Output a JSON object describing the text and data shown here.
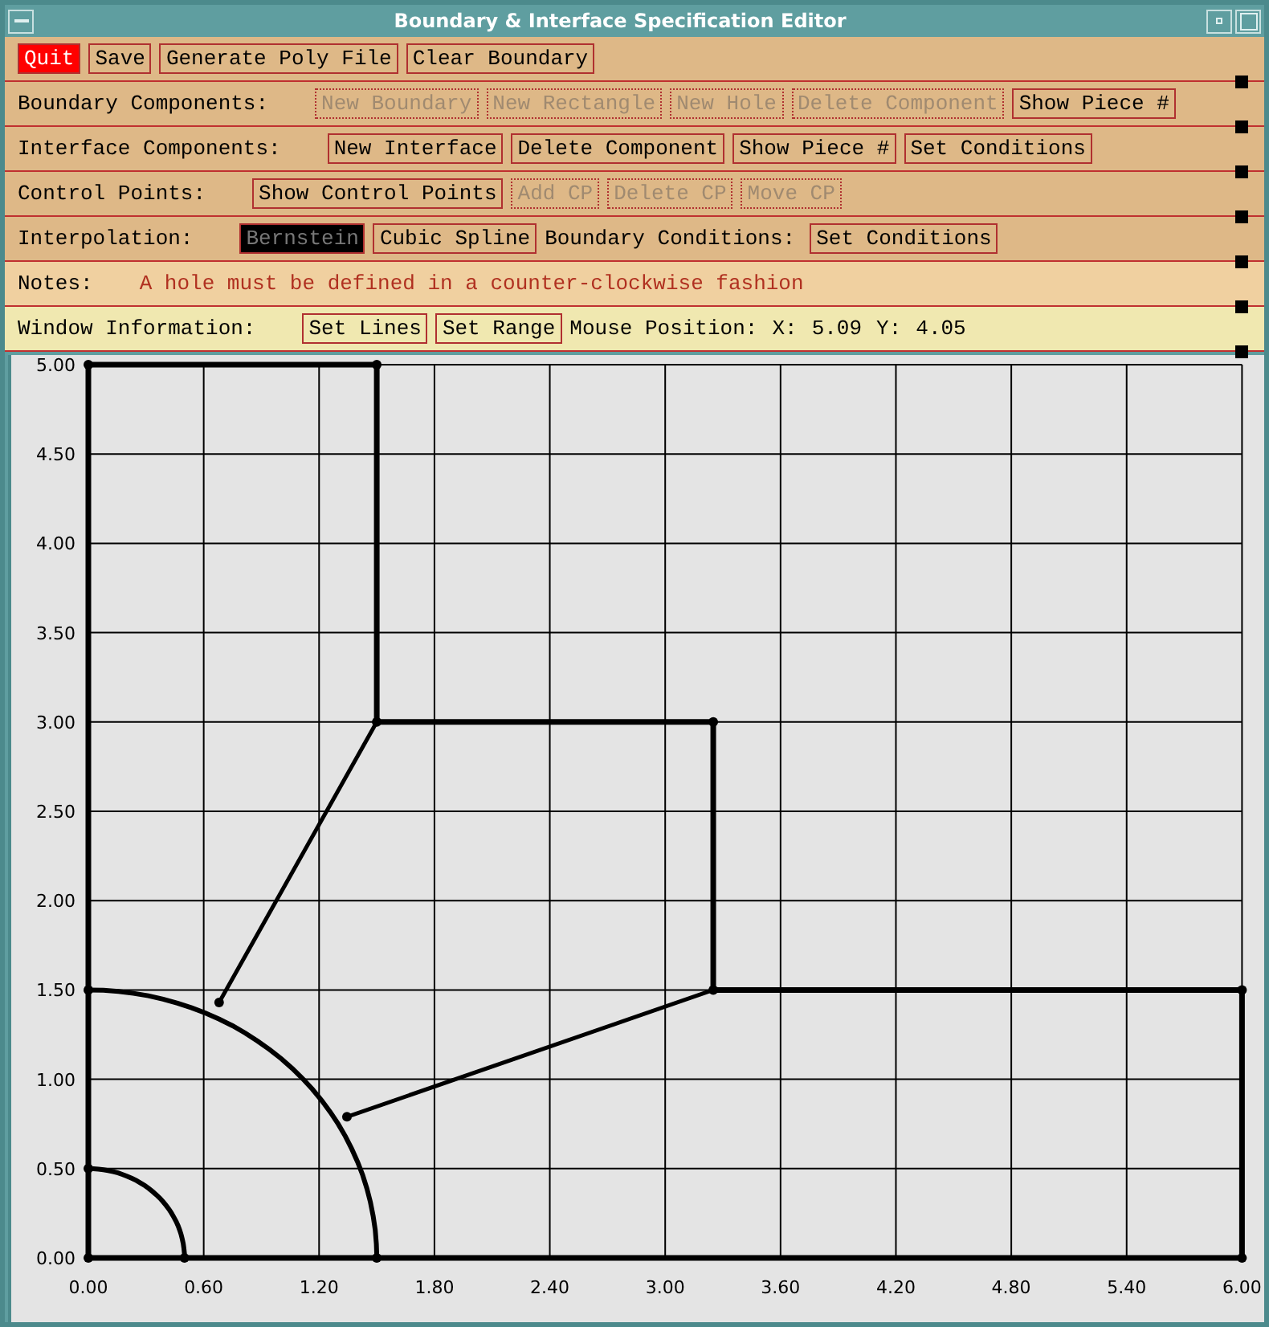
{
  "window": {
    "title": "Boundary & Interface Specification Editor"
  },
  "rows": [
    {
      "kind": "plain",
      "items": [
        {
          "kind": "danger",
          "text": "Quit",
          "disabled": false
        },
        {
          "kind": "button",
          "text": "Save",
          "disabled": false
        },
        {
          "kind": "button",
          "text": "Generate Poly File",
          "disabled": false
        },
        {
          "kind": "button",
          "text": "Clear Boundary",
          "disabled": false
        }
      ]
    },
    {
      "kind": "plain",
      "items": [
        {
          "kind": "label",
          "text": "Boundary Components:"
        },
        {
          "kind": "button",
          "text": "New Boundary",
          "disabled": true
        },
        {
          "kind": "button",
          "text": "New Rectangle",
          "disabled": true
        },
        {
          "kind": "button",
          "text": "New Hole",
          "disabled": true
        },
        {
          "kind": "button",
          "text": "Delete Component",
          "disabled": true
        },
        {
          "kind": "button",
          "text": "Show Piece #",
          "disabled": false
        }
      ]
    },
    {
      "kind": "plain",
      "items": [
        {
          "kind": "label",
          "text": "Interface Components:"
        },
        {
          "kind": "button",
          "text": "New Interface",
          "disabled": false
        },
        {
          "kind": "button",
          "text": "Delete Component",
          "disabled": false
        },
        {
          "kind": "button",
          "text": "Show Piece #",
          "disabled": false
        },
        {
          "kind": "button",
          "text": "Set Conditions",
          "disabled": false
        }
      ]
    },
    {
      "kind": "plain",
      "items": [
        {
          "kind": "label",
          "text": "Control Points:"
        },
        {
          "kind": "button",
          "text": "Show Control Points",
          "disabled": false
        },
        {
          "kind": "button",
          "text": "Add CP",
          "disabled": true
        },
        {
          "kind": "button",
          "text": "Delete CP",
          "disabled": true
        },
        {
          "kind": "button",
          "text": "Move CP",
          "disabled": true
        }
      ]
    },
    {
      "kind": "plain",
      "items": [
        {
          "kind": "label",
          "text": "Interpolation:"
        },
        {
          "kind": "option",
          "text": "Bernstein",
          "selected": true
        },
        {
          "kind": "option",
          "text": "Cubic Spline",
          "selected": false
        },
        {
          "kind": "label",
          "text": "Boundary Conditions:"
        },
        {
          "kind": "button",
          "text": "Set Conditions",
          "disabled": false
        }
      ]
    },
    {
      "kind": "notes",
      "items": [
        {
          "kind": "label",
          "text": "Notes:"
        },
        {
          "kind": "note",
          "text": "A hole must be defined in a counter-clockwise fashion"
        }
      ]
    },
    {
      "kind": "info",
      "items": [
        {
          "kind": "label",
          "text": "Window Information:"
        },
        {
          "kind": "button",
          "text": "Set Lines",
          "disabled": false
        },
        {
          "kind": "button",
          "text": "Set Range",
          "disabled": false
        },
        {
          "kind": "label",
          "text": "Mouse Position:"
        },
        {
          "kind": "label",
          "text": "X:"
        },
        {
          "kind": "label",
          "text": "5.09"
        },
        {
          "kind": "label",
          "text": "Y:"
        },
        {
          "kind": "label",
          "text": "4.05"
        }
      ]
    }
  ],
  "plot": {
    "x_ticks": [
      "0.00",
      "0.60",
      "1.20",
      "1.80",
      "2.40",
      "3.00",
      "3.60",
      "4.20",
      "4.80",
      "5.40",
      "6.00"
    ],
    "y_ticks": [
      "5.00",
      "4.50",
      "4.00",
      "3.50",
      "3.00",
      "2.50",
      "2.00",
      "1.50",
      "1.00",
      "0.50",
      "0.00"
    ]
  }
}
